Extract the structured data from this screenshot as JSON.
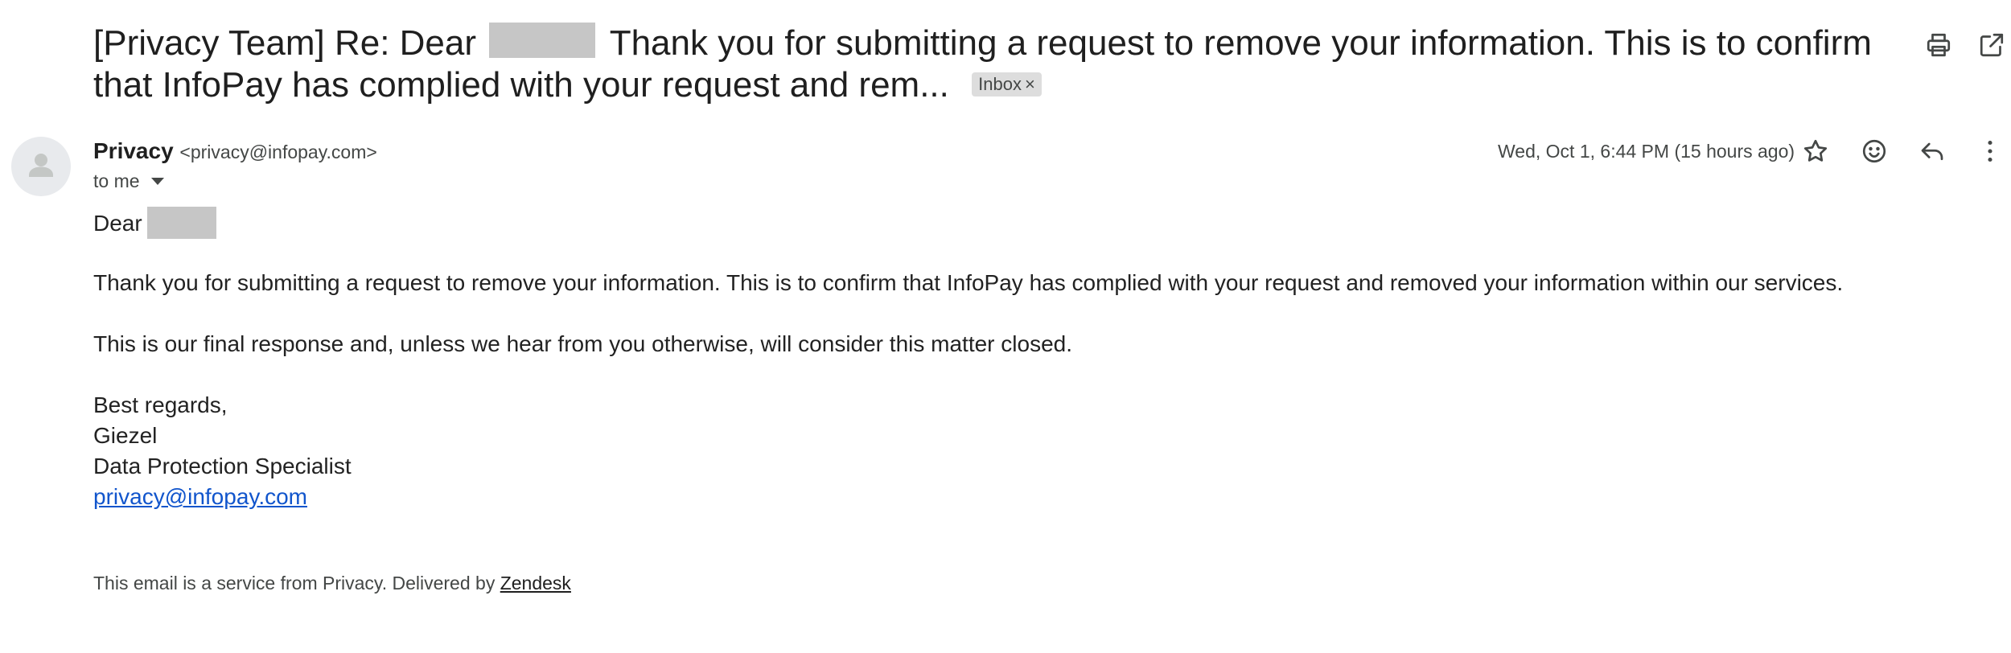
{
  "subject": {
    "prefix": "[Privacy Team] Re: Dear",
    "rest": "Thank you for submitting a request to remove your information. This is to confirm that InfoPay has complied with your request and rem...",
    "label": "Inbox",
    "label_remove": "×"
  },
  "sender": {
    "name": "Privacy",
    "email": "<privacy@infopay.com>",
    "to": "to me",
    "date": "Wed, Oct 1, 6:44 PM (15 hours ago)"
  },
  "icons": {
    "print": "print-icon",
    "popout": "open-in-new-window-icon",
    "star": "star-icon",
    "emoji": "emoji-reaction-icon",
    "reply": "reply-icon",
    "more": "more-vertical-icon",
    "avatar": "default-avatar-icon"
  },
  "body": {
    "greeting": "Dear",
    "paragraph1": "Thank you for submitting a request to remove your information. This is to confirm that InfoPay has complied with your request and removed your information within our services.",
    "paragraph2": "This is our final response and, unless we hear from you otherwise, will consider this matter closed.",
    "signature": {
      "closing": "Best regards,",
      "name": "Giezel",
      "title": "Data Protection Specialist",
      "email_link": "privacy@infopay.com"
    }
  },
  "footer": {
    "text": "This email is a service from Privacy. Delivered by ",
    "link": "Zendesk"
  },
  "colors": {
    "redaction": "#c6c6c6",
    "link": "#1155cc",
    "chip_bg": "#dddddd",
    "avatar_bg": "#e8eaed"
  }
}
